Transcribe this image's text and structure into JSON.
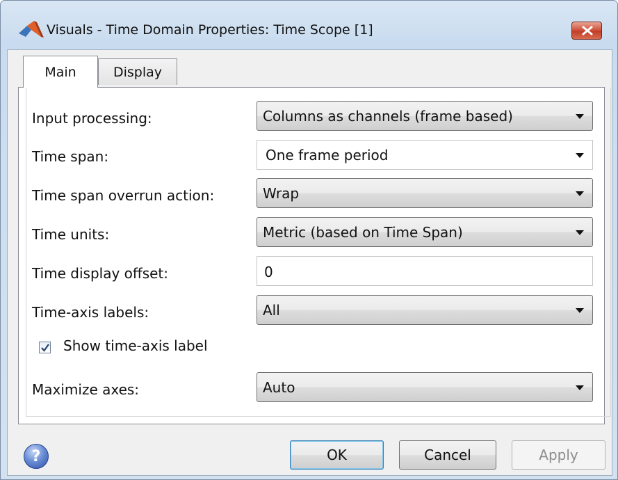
{
  "window": {
    "title": "Visuals - Time Domain Properties: Time Scope [1]"
  },
  "tabs": [
    {
      "label": "Main",
      "selected": true
    },
    {
      "label": "Display",
      "selected": false
    }
  ],
  "fields": {
    "input_processing": {
      "label": "Input processing:",
      "value": "Columns as channels (frame based)"
    },
    "time_span": {
      "label": "Time span:",
      "value": "One frame period"
    },
    "overrun_action": {
      "label": "Time span overrun action:",
      "value": "Wrap"
    },
    "time_units": {
      "label": "Time units:",
      "value": "Metric (based on Time Span)"
    },
    "display_offset": {
      "label": "Time display offset:",
      "value": "0"
    },
    "axis_labels": {
      "label": "Time-axis labels:",
      "value": "All"
    },
    "show_axis_label": {
      "label": "Show time-axis label",
      "checked": true
    },
    "maximize_axes": {
      "label": "Maximize axes:",
      "value": "Auto"
    }
  },
  "buttons": {
    "ok": "OK",
    "cancel": "Cancel",
    "apply": "Apply"
  },
  "icons": {
    "help": "?"
  },
  "colors": {
    "title_gradient": "#c9dcef",
    "close_button": "#c13f28",
    "ok_focus_border": "#3c7fb1",
    "disabled_text": "#8d8d8d"
  }
}
